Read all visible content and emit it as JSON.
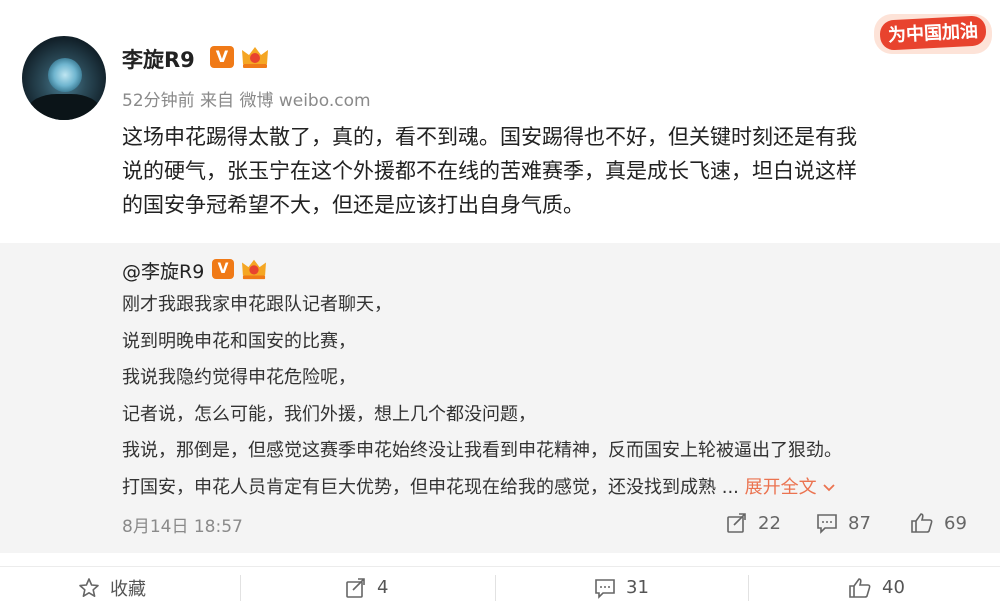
{
  "user": {
    "name": "李旋R9",
    "verified_label": "V"
  },
  "post": {
    "meta": "52分钟前 来自 微博 weibo.com",
    "lines": [
      "这场申花踢得太散了，真的，看不到魂。国安踢得也不好，但关键时刻还是有我",
      "说的硬气，张玉宁在这个外援都不在线的苦难赛季，真是成长飞速，坦白说这样",
      "的国安争冠希望不大，但还是应该打出自身气质。"
    ]
  },
  "topic_badge": {
    "text": "为中国加油",
    "color": "#e8432e"
  },
  "repost": {
    "user": "@李旋R9",
    "lines": [
      "刚才我跟我家申花跟队记者聊天，",
      "说到明晚申花和国安的比赛，",
      "我说我隐约觉得申花危险呢，",
      "记者说，怎么可能，我们外援，想上几个都没问题，",
      "我说，那倒是，但感觉这赛季申花始终没让我看到申花精神，反而国安上轮被逼出了狠劲。",
      "打国安，申花人员肯定有巨大优势，但申花现在给我的感觉，还没找到成熟 ..."
    ],
    "expand_label": "展开全文",
    "date": "8月14日 18:57",
    "reposts": "22",
    "comments": "87",
    "likes": "69"
  },
  "actions": {
    "favorite_label": "收藏",
    "repost_count": "4",
    "comment_count": "31",
    "like_count": "40"
  },
  "colors": {
    "accent": "#eb7350",
    "vbadge": "#f07a17",
    "repost_bg": "#f4f4f4"
  }
}
